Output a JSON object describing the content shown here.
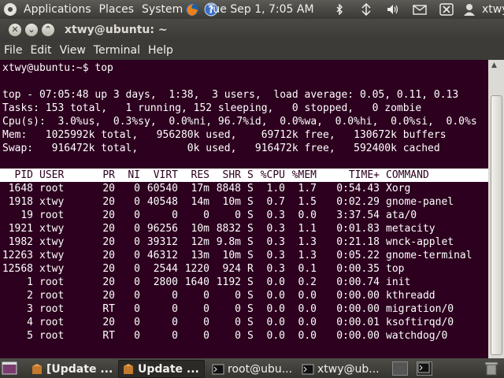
{
  "top_panel": {
    "menus": [
      "Applications",
      "Places",
      "System"
    ],
    "clock": "Tue Sep  1,  7:05 AM",
    "user": "xtwy"
  },
  "window": {
    "title": "xtwy@ubuntu: ~",
    "menu": [
      "File",
      "Edit",
      "View",
      "Terminal",
      "Help"
    ]
  },
  "terminal": {
    "prompt_line": "xtwy@ubuntu:~$ top",
    "summary": [
      "top - 07:05:48 up 3 days,  1:38,  3 users,  load average: 0.05, 0.11, 0.13",
      "Tasks: 153 total,   1 running, 152 sleeping,   0 stopped,   0 zombie",
      "Cpu(s):  3.0%us,  0.3%sy,  0.0%ni, 96.7%id,  0.0%wa,  0.0%hi,  0.0%si,  0.0%s",
      "Mem:   1025992k total,   956280k used,    69712k free,   130672k buffers",
      "Swap:   916472k total,        0k used,   916472k free,   592400k cached"
    ],
    "columns": [
      "PID",
      "USER",
      "PR",
      "NI",
      "VIRT",
      "RES",
      "SHR",
      "S",
      "%CPU",
      "%MEM",
      "TIME+",
      "COMMAND"
    ],
    "processes": [
      [
        "1648",
        "root",
        "20",
        "0",
        "60540",
        "17m",
        "8848",
        "S",
        "1.0",
        "1.7",
        "0:54.43",
        "Xorg"
      ],
      [
        "1918",
        "xtwy",
        "20",
        "0",
        "40548",
        "14m",
        "10m",
        "S",
        "0.7",
        "1.5",
        "0:02.29",
        "gnome-panel"
      ],
      [
        "19",
        "root",
        "20",
        "0",
        "0",
        "0",
        "0",
        "S",
        "0.3",
        "0.0",
        "3:37.54",
        "ata/0"
      ],
      [
        "1921",
        "xtwy",
        "20",
        "0",
        "96256",
        "10m",
        "8832",
        "S",
        "0.3",
        "1.1",
        "0:01.83",
        "metacity"
      ],
      [
        "1982",
        "xtwy",
        "20",
        "0",
        "39312",
        "12m",
        "9.8m",
        "S",
        "0.3",
        "1.3",
        "0:21.18",
        "wnck-applet"
      ],
      [
        "12263",
        "xtwy",
        "20",
        "0",
        "46312",
        "13m",
        "10m",
        "S",
        "0.3",
        "1.3",
        "0:05.22",
        "gnome-terminal"
      ],
      [
        "12568",
        "xtwy",
        "20",
        "0",
        "2544",
        "1220",
        "924",
        "R",
        "0.3",
        "0.1",
        "0:00.35",
        "top"
      ],
      [
        "1",
        "root",
        "20",
        "0",
        "2800",
        "1640",
        "1192",
        "S",
        "0.0",
        "0.2",
        "0:00.74",
        "init"
      ],
      [
        "2",
        "root",
        "20",
        "0",
        "0",
        "0",
        "0",
        "S",
        "0.0",
        "0.0",
        "0:00.00",
        "kthreadd"
      ],
      [
        "3",
        "root",
        "RT",
        "0",
        "0",
        "0",
        "0",
        "S",
        "0.0",
        "0.0",
        "0:00.00",
        "migration/0"
      ],
      [
        "4",
        "root",
        "20",
        "0",
        "0",
        "0",
        "0",
        "S",
        "0.0",
        "0.0",
        "0:00.01",
        "ksoftirqd/0"
      ],
      [
        "5",
        "root",
        "RT",
        "0",
        "0",
        "0",
        "0",
        "S",
        "0.0",
        "0.0",
        "0:00.00",
        "watchdog/0"
      ]
    ]
  },
  "taskbar": {
    "tasks": [
      {
        "label": "[Update ...",
        "bold": true
      },
      {
        "label": "Update ...",
        "bold": true
      },
      {
        "label": "root@ubu...",
        "bold": false
      },
      {
        "label": "xtwy@ub...",
        "bold": false
      }
    ]
  }
}
